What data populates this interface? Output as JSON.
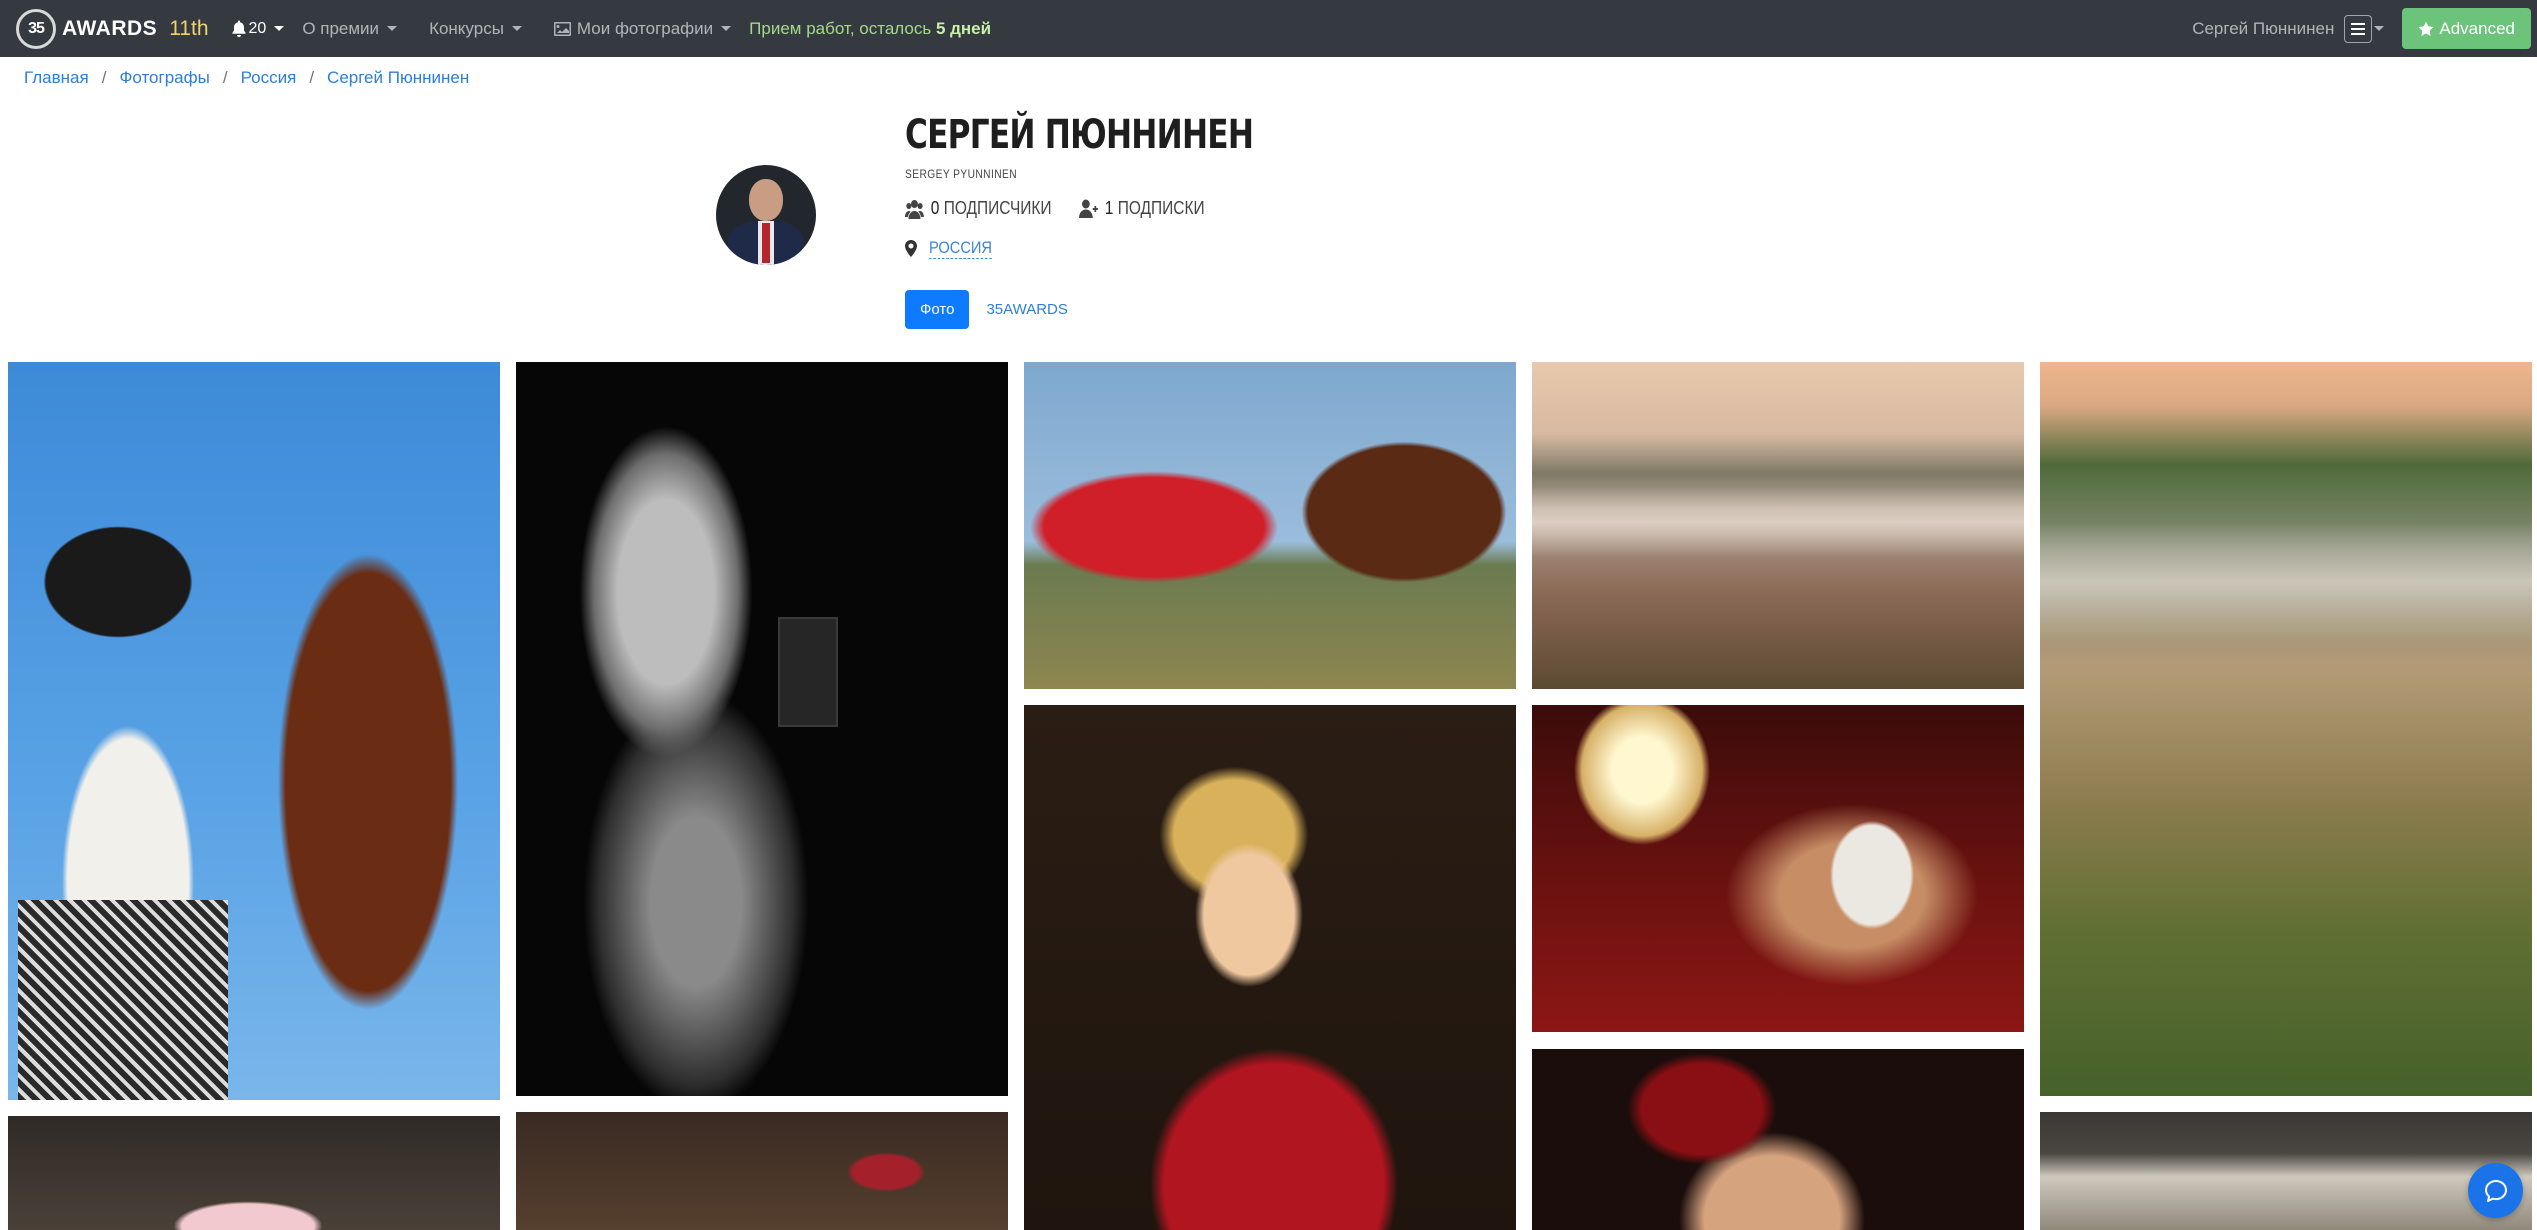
{
  "navbar": {
    "brand_logo": "35",
    "brand": "AWARDS",
    "edition": "11th",
    "notifications": "20",
    "about": "О премии",
    "contests": "Конкурсы",
    "my_photos": "Мои фотографии",
    "status_prefix": "Прием работ, осталось",
    "status_days": "5 дней",
    "user": "Сергей Пюннинен",
    "advanced": "Advanced"
  },
  "breadcrumb": {
    "items": [
      "Главная",
      "Фотографы",
      "Россия",
      "Сергей Пюннинен"
    ]
  },
  "profile": {
    "name": "СЕРГЕЙ ПЮННИНЕН",
    "latin_name": "SERGEY PYUNNINEN",
    "followers_count": "0",
    "followers_label": "ПОДПИСЧИКИ",
    "following_count": "1",
    "following_label": "ПОДПИСКИ",
    "location": "РОССИЯ"
  },
  "tabs": {
    "photo": "Фото",
    "awards": "35AWARDS"
  },
  "gallery": {
    "photos": [
      "girl-with-horse",
      "white-horse-dark-stable",
      "woman-red-dress-on-horse",
      "misty-valley-sunrise",
      "misty-hills-summer",
      "blonde-girl-red-jacket",
      "woman-with-lamp",
      "red-haired-woman-portrait",
      "couple-under-canopy",
      "table-still-life",
      "tattooed-arms-jewelry"
    ]
  },
  "icons": {
    "bell": "bell-icon",
    "image": "image-icon",
    "menu": "menu-icon",
    "star": "star-icon",
    "followers": "users-icon",
    "following": "user-plus-icon",
    "location": "map-marker-icon",
    "chat": "chat-icon"
  },
  "colors": {
    "navbar": "#343a40",
    "accent_green": "#6cc37a",
    "primary_blue": "#0d7aff",
    "link": "#2b7fd9",
    "edition": "#f0d36b"
  }
}
